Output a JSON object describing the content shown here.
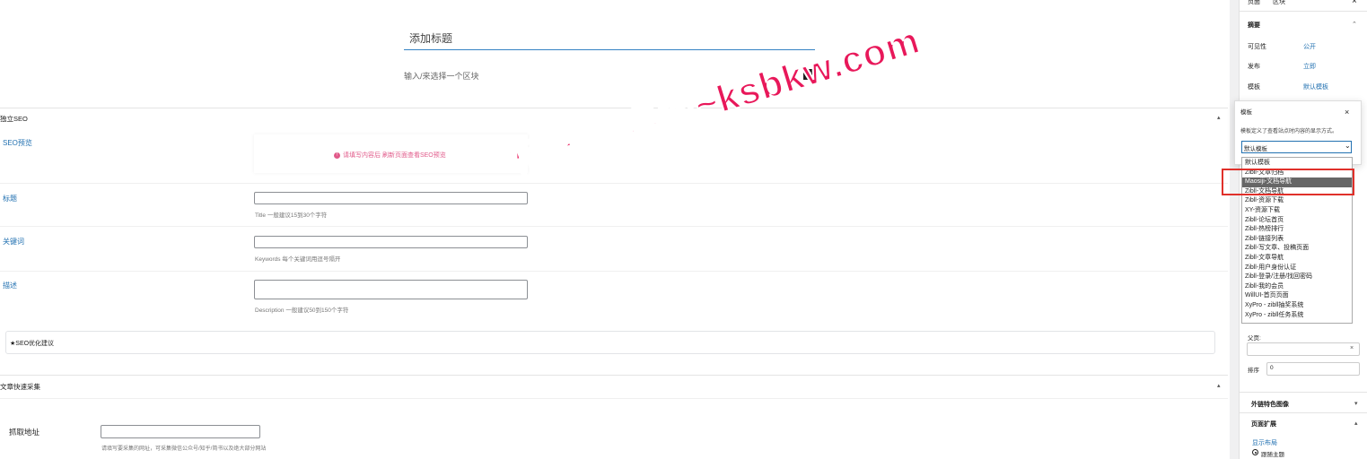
{
  "editor": {
    "title_placeholder": "添加标题",
    "block_hint": "输入/来选择一个区块",
    "add_block_symbol": "+"
  },
  "seo": {
    "section_title": "独立SEO",
    "preview_label": "SEO预览",
    "preview_message": "请填写内容后 刷新页面查看SEO预览",
    "title_label": "标题",
    "title_hint": "Title 一般建议15到30个字符",
    "keywords_label": "关键词",
    "keywords_hint": "Keywords 每个关键词用逗号隔开",
    "description_label": "描述",
    "description_hint": "Description 一般建议50到150个字符",
    "tips_label": "★SEO优化建议"
  },
  "collector": {
    "section_title": "文章快速采集",
    "url_label": "抓取地址",
    "url_hint": "请填写要采集的网址，可采集微信公众号/知乎/简书以及绝大部分网站"
  },
  "sidebar": {
    "tab_page": "页面",
    "tab_block": "区块",
    "close": "×",
    "summary_title": "摘要",
    "visibility_label": "可见性",
    "visibility_value": "公开",
    "publish_label": "发布",
    "publish_value": "立即",
    "template_label": "模板",
    "template_value": "默认模板",
    "parent_label": "父页:",
    "order_label": "排序",
    "order_value": "0",
    "featured_label": "外链特色图像",
    "page_ext_label": "页面扩展",
    "layout_label": "显示布局",
    "layout_option": "跟随主题"
  },
  "template_popover": {
    "title": "模板",
    "close": "×",
    "description": "模板定义了查看站点时内容的显示方式。",
    "selected": "默认模板",
    "options": [
      "默认模板",
      "Zibll-文章归档",
      "Maosiji-文档导航",
      "Zibll-文档导航",
      "Zibll-资源下载",
      "XY-资源下载",
      "Zibll-论坛首页",
      "Zibll-热榜排行",
      "Zibll-链接列表",
      "Zibll-写文章、投稿页面",
      "Zibll-文章导航",
      "Zibll-用户身份认证",
      "Zibll-登录/注册/找回密码",
      "Zibll-我的会员",
      "WillUI-首页页面",
      "XyPro - zibll抽奖系统",
      "XyPro - zibll任务系统"
    ],
    "highlighted_index": 2
  },
  "watermark": {
    "text": "柯殇博客网~ksbkw.com"
  }
}
